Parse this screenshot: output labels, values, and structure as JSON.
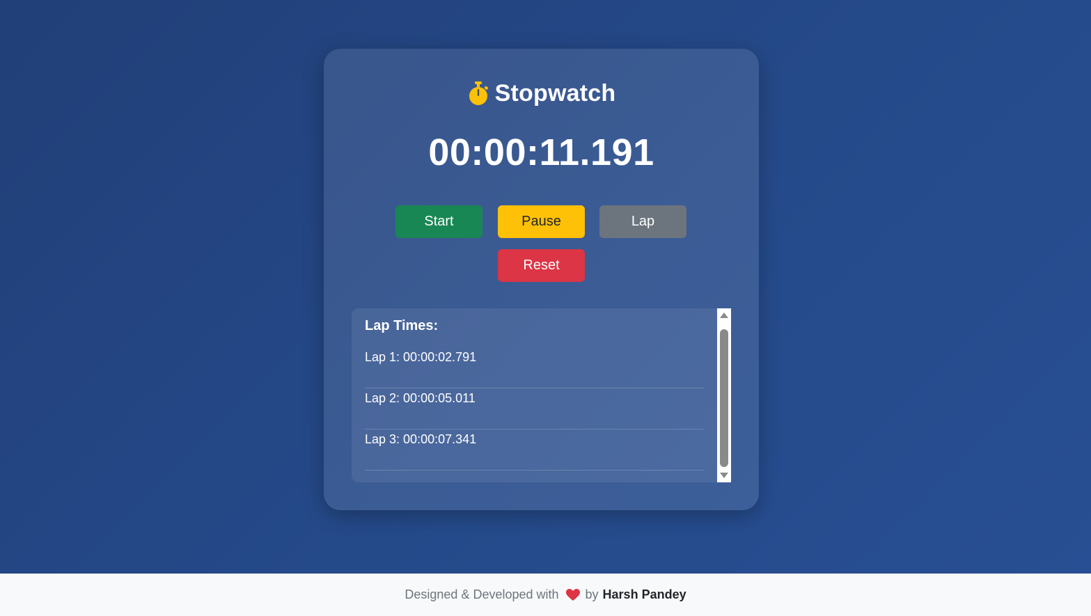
{
  "app": {
    "title": "Stopwatch",
    "title_icon": "stopwatch-icon",
    "accent_color": "#ffc107"
  },
  "display": {
    "time": "00:00:11.191"
  },
  "controls": {
    "start_label": "Start",
    "pause_label": "Pause",
    "lap_label": "Lap",
    "reset_label": "Reset",
    "colors": {
      "start": "#198754",
      "pause": "#ffc107",
      "lap": "#6c757d",
      "reset": "#dc3545"
    }
  },
  "laps": {
    "heading": "Lap Times:",
    "items": [
      {
        "label": "Lap 1: 00:00:02.791"
      },
      {
        "label": "Lap 2: 00:00:05.011"
      },
      {
        "label": "Lap 3: 00:00:07.341"
      }
    ]
  },
  "footer": {
    "text": "Designed & Developed with",
    "heart_icon": "heart-icon",
    "heart_color": "#dc3545",
    "by": "by",
    "author": "Harsh Pandey"
  }
}
